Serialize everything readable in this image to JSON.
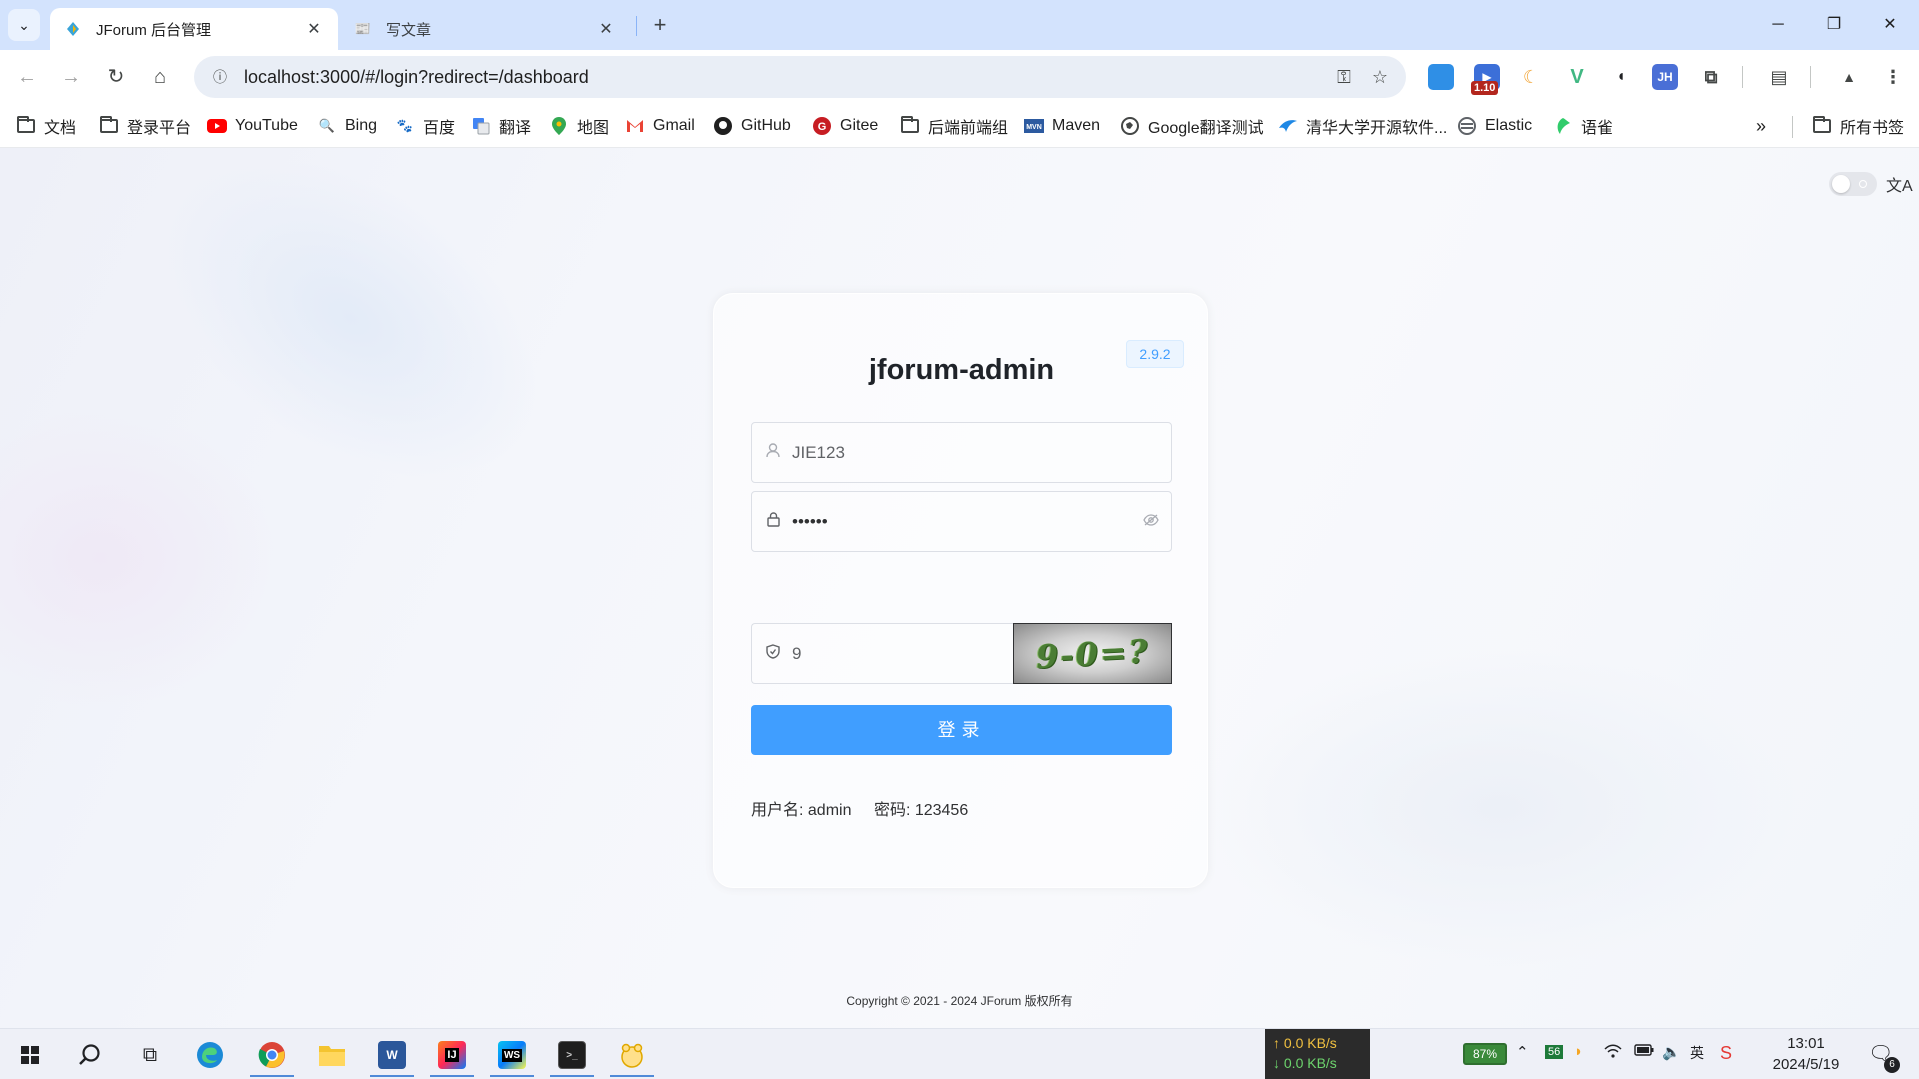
{
  "browser": {
    "tabs": [
      {
        "title": "JForum 后台管理",
        "active": true
      },
      {
        "title": "写文章",
        "active": false
      }
    ],
    "url": "localhost:3000/#/login?redirect=/dashboard",
    "extension_badge": "1.10",
    "bookmarks": [
      {
        "label": "文档",
        "icon": "folder-icon"
      },
      {
        "label": "登录平台",
        "icon": "folder-icon"
      },
      {
        "label": "YouTube",
        "icon": "youtube-icon"
      },
      {
        "label": "Bing",
        "icon": "bing-icon"
      },
      {
        "label": "百度",
        "icon": "baidu-icon"
      },
      {
        "label": "翻译",
        "icon": "translate-icon"
      },
      {
        "label": "地图",
        "icon": "maps-icon"
      },
      {
        "label": "Gmail",
        "icon": "gmail-icon"
      },
      {
        "label": "GitHub",
        "icon": "github-icon"
      },
      {
        "label": "Gitee",
        "icon": "gitee-icon"
      },
      {
        "label": "后端前端组",
        "icon": "folder-icon"
      },
      {
        "label": "Maven",
        "icon": "maven-icon"
      },
      {
        "label": "Google翻译测试",
        "icon": "globe-icon"
      },
      {
        "label": "清华大学开源软件...",
        "icon": "tuna-icon"
      },
      {
        "label": "Elastic",
        "icon": "elastic-icon"
      },
      {
        "label": "语雀",
        "icon": "yuque-icon"
      }
    ],
    "all_bookmarks": "所有书签"
  },
  "login": {
    "title": "jforum-admin",
    "version": "2.9.2",
    "username_value": "JIE123",
    "password_value": "••••••",
    "captcha_value": "9",
    "captcha_image_text": "9-0=?",
    "button_label": "登录",
    "hint_username": "用户名: admin",
    "hint_password": "密码: 123456",
    "language_icon": "文A"
  },
  "footer": {
    "copyright": "Copyright © 2021 - 2024 JForum 版权所有"
  },
  "taskbar": {
    "upload_speed": "↑ 0.0 KB/s",
    "download_speed": "↓ 0.0 KB/s",
    "battery": "87%",
    "tray_number": "56",
    "time": "13:01",
    "date": "2024/5/19",
    "notification_count": "6"
  },
  "colors": {
    "primary": "#409eff",
    "tab_strip": "#d3e3fd"
  }
}
